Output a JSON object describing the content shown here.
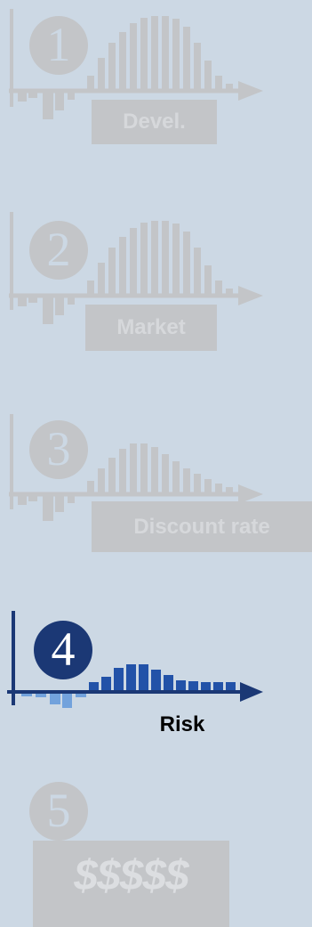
{
  "colors": {
    "background": "#ccd8e4",
    "inactive": "#c3c5c8",
    "inactive_text": "#d6d8db",
    "active_dark": "#1b3875",
    "active_bar": "#2252a8",
    "active_light": "#72a2dc"
  },
  "steps": [
    {
      "number": "1",
      "label": "Devel.",
      "active": false
    },
    {
      "number": "2",
      "label": "Market",
      "active": false
    },
    {
      "number": "3",
      "label": "Discount rate",
      "active": false
    },
    {
      "number": "4",
      "label": "Risk",
      "active": true
    },
    {
      "number": "5",
      "label": "$$$$$",
      "active": false
    }
  ]
}
